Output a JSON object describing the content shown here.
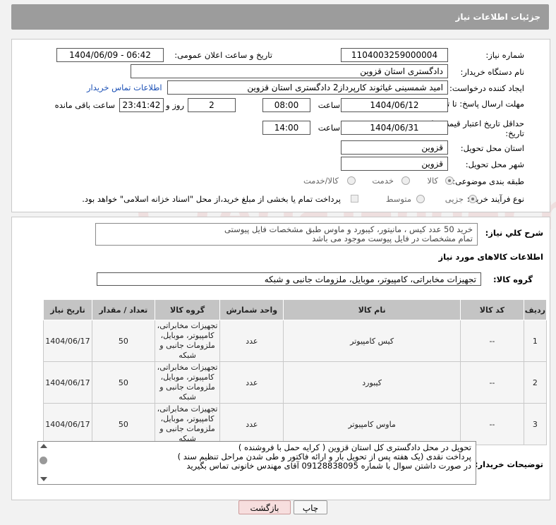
{
  "header": {
    "title": "جزئیات اطلاعات نیاز"
  },
  "form": {
    "need_number_label": "شماره نیاز:",
    "need_number": "1104003259000004",
    "announce_label": "تاریخ و ساعت اعلان عمومی:",
    "announce_value": "1404/06/09 - 06:42",
    "buyer_org_label": "نام دستگاه خریدار:",
    "buyer_org": "دادگستری استان قزوین",
    "creator_label": "ایجاد کننده درخواست:",
    "creator": "امید شمسینی غیاثوند کارپرداز2 دادگستری استان قزوین",
    "contact_link": "اطلاعات تماس خریدار",
    "reply_deadline_label": "مهلت ارسال پاسخ: تا تاریخ:",
    "reply_date": "1404/06/12",
    "time_label": "ساعت",
    "reply_time": "08:00",
    "days_value": "2",
    "days_label": "روز و",
    "remaining_time": "23:41:42",
    "remaining_label": "ساعت باقی مانده",
    "price_validity_label": "حداقل تاریخ اعتبار قیمت: تا تاریخ:",
    "price_date": "1404/06/31",
    "price_time": "14:00",
    "province_label": "استان محل تحویل:",
    "province": "قزوین",
    "city_label": "شهر محل تحویل:",
    "city": "قزوین",
    "category_label": "طبقه بندی موضوعی:",
    "category_options": [
      "کالا",
      "خدمت",
      "کالا/خدمت"
    ],
    "process_label": "نوع فرآیند خرید :",
    "process_options": [
      "جزیی",
      "متوسط"
    ],
    "payment_note": "پرداخت تمام یا بخشی از مبلغ خرید،از محل \"اسناد خزانه اسلامی\" خواهد بود."
  },
  "description": {
    "label": "شرح کلي نياز:",
    "line1": "خرید 50 عدد  کیس ، مانیتور، کیبورد و ماوس طبق مشخصات فایل پیوستی",
    "line2": "تمام مشخصات در فایل پیوست موجود می باشد"
  },
  "goods": {
    "section_title": "اطلاعات کالاهای مورد نیاز",
    "group_label": "گروه کالا:",
    "group_value": "تجهیزات مخابراتی، کامپیوتر، موبایل، ملزومات جانبی و شبکه",
    "columns": [
      "ردیف",
      "کد کالا",
      "نام کالا",
      "واحد شمارش",
      "گروه کالا",
      "تعداد / مقدار",
      "تاریخ نیاز"
    ],
    "rows": [
      {
        "index": "1",
        "code": "--",
        "name": "کیس کامپیوتر",
        "unit": "عدد",
        "group": "تجهیزات مخابراتی، کامپیوتر، موبایل، ملزومات جانبی و شبکه",
        "qty": "50",
        "date": "1404/06/17"
      },
      {
        "index": "2",
        "code": "--",
        "name": "کیبورد",
        "unit": "عدد",
        "group": "تجهیزات مخابراتی، کامپیوتر، موبایل، ملزومات جانبی و شبکه",
        "qty": "50",
        "date": "1404/06/17"
      },
      {
        "index": "3",
        "code": "--",
        "name": "ماوس کامپیوتر",
        "unit": "عدد",
        "group": "تجهیزات مخابراتی، کامپیوتر، موبایل، ملزومات جانبی و شبکه",
        "qty": "50",
        "date": "1404/06/17"
      }
    ]
  },
  "buyer_notes": {
    "label": "توضیحات خریدار:",
    "line1": "تحویل در محل دادگستری کل استان قزوین ( کرایه حمل با فروشنده )",
    "line2": "پرداخت نقدی (یک هفته  پس از تحویل بار و ارائه فاکتور و طی شدن مراحل تنظیم سند  )",
    "line3": "در صورت داشتن  سوال با شماره 09128838095 آقای  مهندس خانونی  تماس بگیرید"
  },
  "buttons": {
    "print": "چاپ",
    "back": "بازگشت"
  },
  "watermark": {
    "text": "AriaTender.net"
  },
  "colors": {
    "header": "#9c9c9c",
    "link": "#1a4fb5",
    "back_button": "#f7dede"
  }
}
